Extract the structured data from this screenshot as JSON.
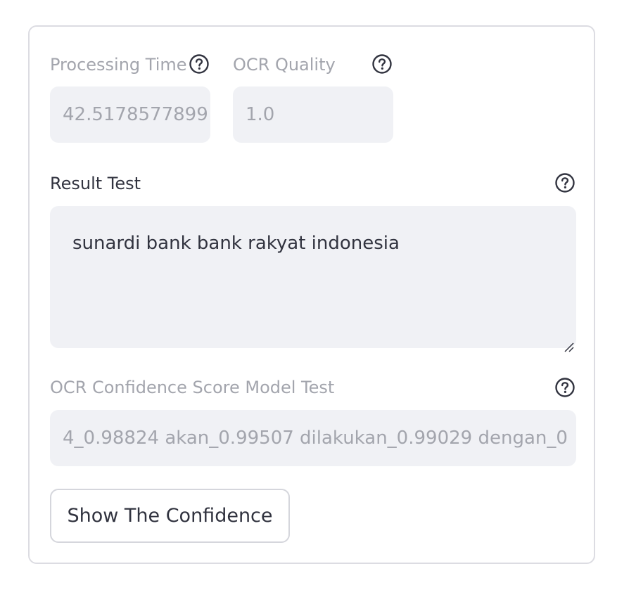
{
  "metrics": {
    "processing_time": {
      "label": "Processing Time",
      "value": "42.5178577899"
    },
    "ocr_quality": {
      "label": "OCR Quality",
      "value": "1.0"
    }
  },
  "result": {
    "label": "Result Test",
    "text": "sunardi bank bank rakyat indonesia"
  },
  "confidence": {
    "label": "OCR Confidence Score Model Test",
    "value": "4_0.98824 akan_0.99507 dilakukan_0.99029 dengan_0"
  },
  "actions": {
    "show_confidence_label": "Show The Confidence"
  },
  "icons": {
    "help": "question-circle-icon"
  },
  "colors": {
    "disabled_text": "#a3a5ad",
    "text": "#31333f",
    "field_bg": "#f0f1f5",
    "border": "#dcdce2"
  }
}
